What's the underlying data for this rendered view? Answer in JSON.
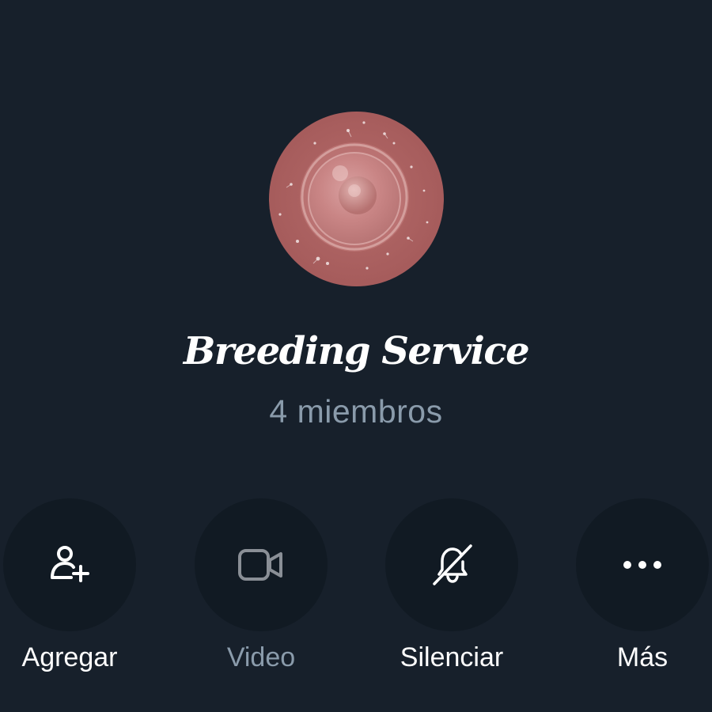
{
  "group": {
    "name": "Breeding Service",
    "members": "4 miembros"
  },
  "actions": [
    {
      "label": "Agregar",
      "icon": "add-user-icon",
      "enabled": true
    },
    {
      "label": "Video",
      "icon": "video-camera-icon",
      "enabled": false
    },
    {
      "label": "Silenciar",
      "icon": "bell-slash-icon",
      "enabled": true
    },
    {
      "label": "Más",
      "icon": "more-dots-icon",
      "enabled": true
    }
  ],
  "colors": {
    "background": "#17202b",
    "button_background": "#111a23",
    "text_primary": "#ffffff",
    "text_secondary": "#8a9bab",
    "icon_disabled": "#8a8f96"
  }
}
